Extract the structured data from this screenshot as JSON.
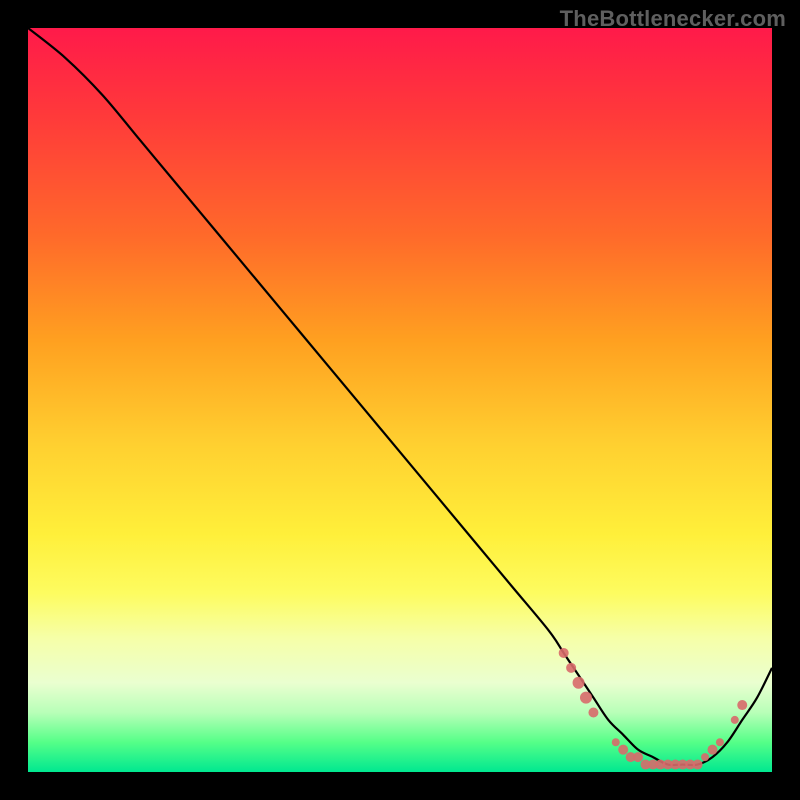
{
  "watermark": "TheBottlenecker.com",
  "colors": {
    "background": "#000000",
    "curve": "#000000",
    "marker": "#d86a6a"
  },
  "chart_data": {
    "type": "line",
    "title": "",
    "xlabel": "",
    "ylabel": "",
    "xlim": [
      0,
      100
    ],
    "ylim": [
      0,
      100
    ],
    "grid": false,
    "legend": false,
    "series": [
      {
        "name": "curve",
        "x": [
          0,
          5,
          10,
          15,
          20,
          25,
          30,
          35,
          40,
          45,
          50,
          55,
          60,
          65,
          70,
          72,
          74,
          76,
          78,
          80,
          82,
          84,
          86,
          88,
          90,
          92,
          94,
          96,
          98,
          100
        ],
        "y": [
          100,
          96,
          91,
          85,
          79,
          73,
          67,
          61,
          55,
          49,
          43,
          37,
          31,
          25,
          19,
          16,
          13,
          10,
          7,
          5,
          3,
          2,
          1,
          1,
          1,
          2,
          4,
          7,
          10,
          14
        ]
      }
    ],
    "markers": [
      {
        "x": 72,
        "y": 16,
        "r": 5
      },
      {
        "x": 73,
        "y": 14,
        "r": 5
      },
      {
        "x": 74,
        "y": 12,
        "r": 6
      },
      {
        "x": 75,
        "y": 10,
        "r": 6
      },
      {
        "x": 76,
        "y": 8,
        "r": 5
      },
      {
        "x": 79,
        "y": 4,
        "r": 4
      },
      {
        "x": 80,
        "y": 3,
        "r": 5
      },
      {
        "x": 81,
        "y": 2,
        "r": 5
      },
      {
        "x": 82,
        "y": 2,
        "r": 5
      },
      {
        "x": 83,
        "y": 1,
        "r": 5
      },
      {
        "x": 84,
        "y": 1,
        "r": 5
      },
      {
        "x": 85,
        "y": 1,
        "r": 5
      },
      {
        "x": 86,
        "y": 1,
        "r": 5
      },
      {
        "x": 87,
        "y": 1,
        "r": 5
      },
      {
        "x": 88,
        "y": 1,
        "r": 5
      },
      {
        "x": 89,
        "y": 1,
        "r": 5
      },
      {
        "x": 90,
        "y": 1,
        "r": 5
      },
      {
        "x": 91,
        "y": 2,
        "r": 4
      },
      {
        "x": 92,
        "y": 3,
        "r": 5
      },
      {
        "x": 93,
        "y": 4,
        "r": 4
      },
      {
        "x": 95,
        "y": 7,
        "r": 4
      },
      {
        "x": 96,
        "y": 9,
        "r": 5
      }
    ]
  }
}
